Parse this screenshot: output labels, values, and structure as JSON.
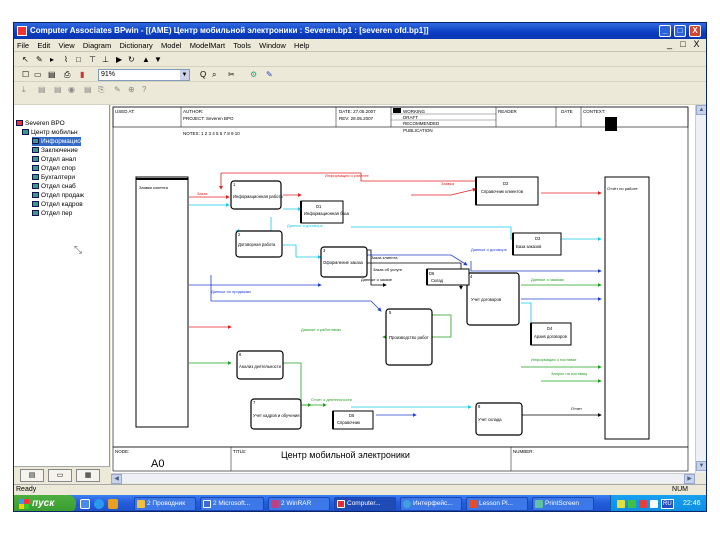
{
  "window": {
    "title": "Computer Associates BPwin - [(АМЕ) Центр мобильной электроники : Severen.bp1 : [severen ofd.bp1]]",
    "controls": [
      "_",
      "□",
      "X"
    ],
    "mdi_controls": [
      "_",
      "□",
      "X"
    ]
  },
  "menu": [
    "File",
    "Edit",
    "View",
    "Diagram",
    "Dictionary",
    "Model",
    "ModelMart",
    "Tools",
    "Window",
    "Help"
  ],
  "toolbar": {
    "row1": [
      "↖",
      "✎",
      "▸",
      "⌇",
      "□",
      "⊤",
      "⊥",
      "▶",
      "↻",
      "▲",
      "▼"
    ],
    "row2_left": [
      "☐",
      "▭",
      "▤",
      "⎙",
      "▮"
    ],
    "zoom_value": "91%",
    "row2_right": [
      "Q",
      "⌕",
      "✂",
      "⚙",
      "✎"
    ],
    "row3": [
      "⤓",
      "▤",
      "▤",
      "◉",
      "▤",
      "⎘",
      "✎",
      "⊕",
      "?"
    ]
  },
  "tree": {
    "items": [
      {
        "label": "Severen BPO",
        "selected": false
      },
      {
        "label": "Центр мобильн",
        "selected": false
      },
      {
        "label": "Информацио",
        "selected": true
      },
      {
        "label": "Заключение",
        "selected": false
      },
      {
        "label": "Отдел анал",
        "selected": false
      },
      {
        "label": "Отдел спор",
        "selected": false
      },
      {
        "label": "Бухгалтери",
        "selected": false
      },
      {
        "label": "Отдел снаб",
        "selected": false
      },
      {
        "label": "Отдел продаж",
        "selected": false
      },
      {
        "label": "Отдел кадров",
        "selected": false
      },
      {
        "label": "Отдел пер",
        "selected": false
      }
    ],
    "tabs": [
      "▤",
      "▭",
      "▦"
    ]
  },
  "diagram": {
    "header": {
      "used_at": "USED AT:",
      "author": "AUTHOR:",
      "project": "PROJECT: Severen BPO",
      "notes": "NOTES: 1 2 3 4 5 6 7 8 9 10",
      "date": "DATE: 27.05.2007",
      "rev": "REV: 28.05.2007",
      "working": "WORKING",
      "draft": "DRAFT",
      "recommended": "RECOMMENDED",
      "publication": "PUBLICATION",
      "reader": "READER",
      "date_col": "DATE",
      "context": "CONTEXT:"
    },
    "footer": {
      "node": "NODE:",
      "node_value": "A0",
      "title_label": "TITLE:",
      "title": "Центр мобильной электроники",
      "number": "NUMBER:"
    },
    "left_tunnel_label": "Заявки клиента",
    "right_tunnel_label": "Отчёт по работе",
    "activities": [
      {
        "label": "Информационная работа",
        "node": "1"
      },
      {
        "label": "Договорная работа",
        "node": "2"
      },
      {
        "label": "Оформление заказа",
        "node": "3"
      },
      {
        "label": "Учет договоров",
        "node": "4"
      },
      {
        "label": "Производство работ",
        "node": "5"
      },
      {
        "label": "Анализ деятельности",
        "node": "6"
      },
      {
        "label": "Учет кадров и обучения",
        "node": "7"
      },
      {
        "label": "Учет склада",
        "node": "8"
      }
    ],
    "stores": [
      {
        "id": "D1",
        "label": "Информационная база"
      },
      {
        "id": "D2",
        "label": "Справочник клиентов"
      },
      {
        "id": "D3",
        "label": "База заказов"
      },
      {
        "id": "D4",
        "label": "Архив договоров"
      },
      {
        "id": "D5",
        "label": "Справочник"
      },
      {
        "id": "D6",
        "label": "Склад"
      }
    ],
    "flow_labels": [
      "Информация о клиенте",
      "Заказ",
      "Заявка",
      "Данные о договоре",
      "Заказ клиента",
      "Заказ об услуге",
      "Данные о заказе",
      "Данные по продажам",
      "Данные о договоре",
      "Данные о заказах",
      "Данные о работниках",
      "Информация о поставке",
      "Запрос на поставку",
      "Отчет о деятельности",
      "Отчет"
    ]
  },
  "statusbar": {
    "left": "Ready",
    "right": "NUM"
  },
  "taskbar": {
    "start": "пуск",
    "tasks": [
      {
        "label": "2 Проводник",
        "active": false
      },
      {
        "label": "2 Microsoft...",
        "active": false
      },
      {
        "label": "2 WinRAR",
        "active": false
      },
      {
        "label": "Computer...",
        "active": true
      },
      {
        "label": "Интерфейс...",
        "active": false
      },
      {
        "label": "Lesson Pl...",
        "active": false
      },
      {
        "label": "PrintScreen",
        "active": false
      }
    ],
    "tray_lang": "RU",
    "clock": "22:46"
  },
  "colors": {
    "title_blue": "#0a3dc2",
    "selection": "#316ac5",
    "arrow_red": "#e02020",
    "arrow_cyan": "#18c8e8",
    "arrow_blue": "#2040d0",
    "arrow_green": "#20a020"
  }
}
